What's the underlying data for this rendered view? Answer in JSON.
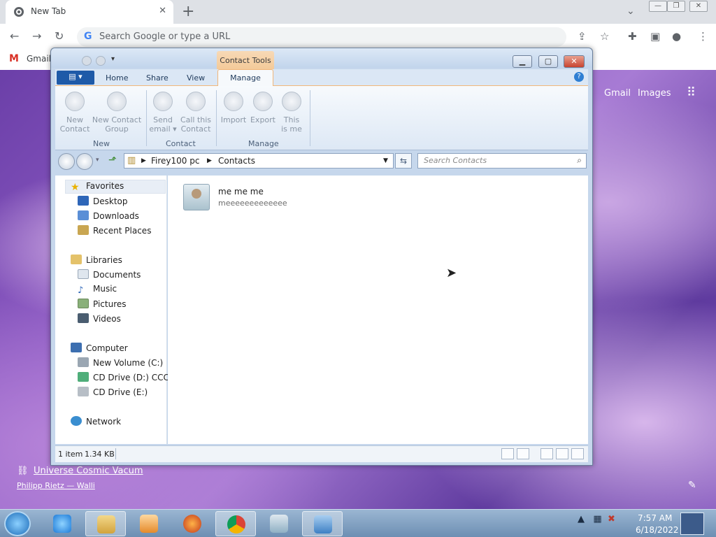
{
  "browser": {
    "tab_title": "New Tab",
    "tab_close": "✕",
    "new_tab": "+",
    "omnibox_placeholder": "Search Google or type a URL",
    "bookmark_gmail": "Gmail",
    "ntp_links": {
      "gmail": "Gmail",
      "images": "Images"
    },
    "wallpaper_title": "Universe Cosmic Vacum",
    "wallpaper_credit": "Philipp Rietz — Walli"
  },
  "window": {
    "contextual_tab": "Contact Tools",
    "ribbon_tabs": [
      "Home",
      "Share",
      "View",
      "Manage"
    ],
    "ribbon_buttons": [
      {
        "line1": "New",
        "line2": "Contact"
      },
      {
        "line1": "New Contact",
        "line2": "Group"
      },
      {
        "line1": "Send",
        "line2": "email ▾"
      },
      {
        "line1": "Call this",
        "line2": "Contact"
      },
      {
        "line1": "Import",
        "line2": ""
      },
      {
        "line1": "Export",
        "line2": ""
      },
      {
        "line1": "This",
        "line2": "is me"
      }
    ],
    "ribbon_groups": [
      "New",
      "Contact",
      "Manage"
    ],
    "address": {
      "root": "Firey100 pc",
      "folder": "Contacts"
    },
    "search_placeholder": "Search Contacts",
    "nav": {
      "favorites": "Favorites",
      "desktop": "Desktop",
      "downloads": "Downloads",
      "recent": "Recent Places",
      "libraries": "Libraries",
      "documents": "Documents",
      "music": "Music",
      "pictures": "Pictures",
      "videos": "Videos",
      "computer": "Computer",
      "volume_c": "New Volume (C:)",
      "cd_d": "CD Drive (D:) CCCOI",
      "cd_e": "CD Drive (E:)",
      "network": "Network"
    },
    "contact": {
      "name": "me me me",
      "detail": "meeeeeeeeeeeee"
    },
    "status": {
      "count": "1 item",
      "size": "1.34 KB"
    }
  },
  "taskbar": {
    "time": "7:57 AM",
    "date": "6/18/2022"
  },
  "colors": {
    "ribbon_accent": "#f1b77a",
    "file_button": "#1e5aa8",
    "close_button": "#c8432f"
  }
}
